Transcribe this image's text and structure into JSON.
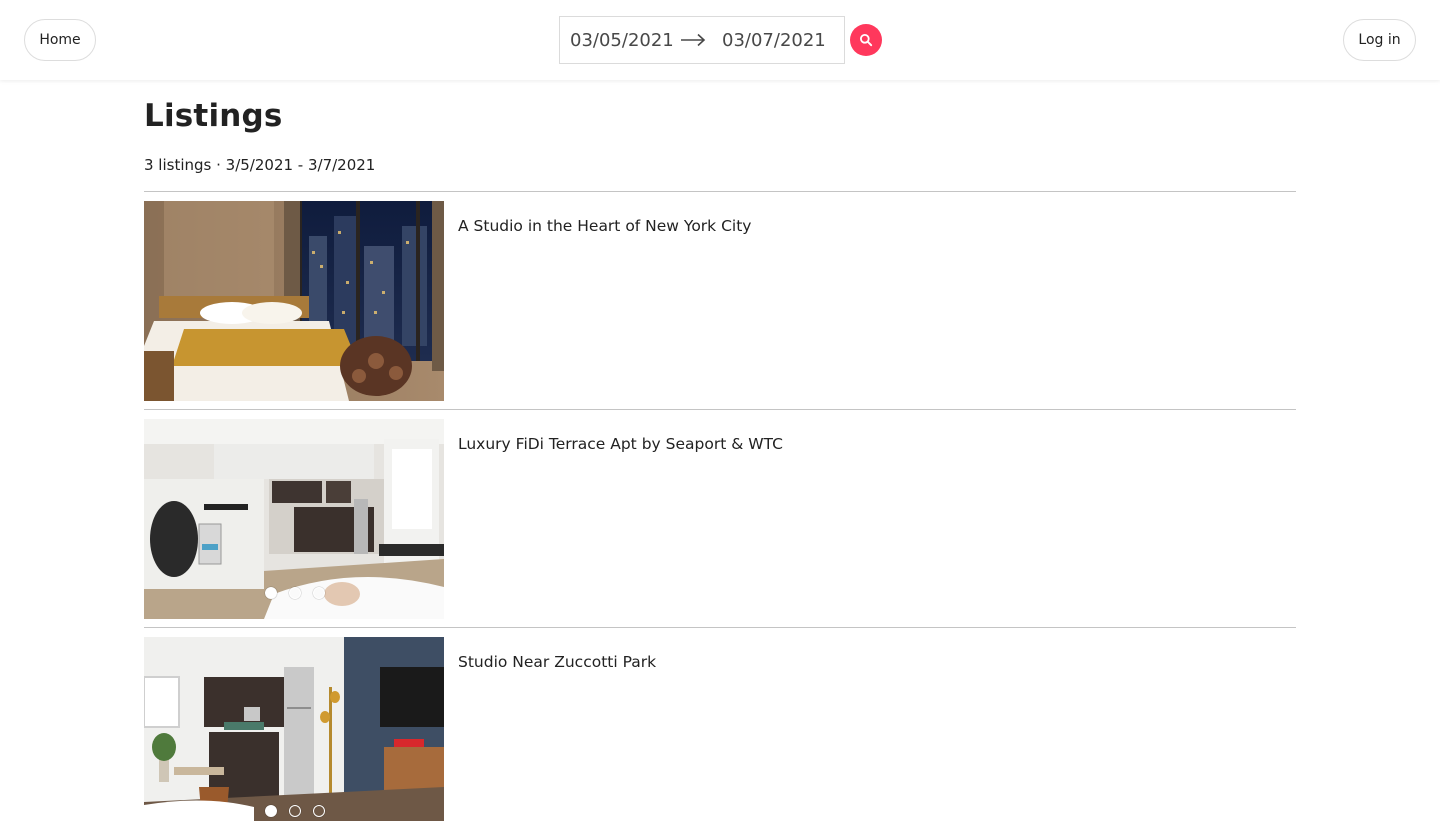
{
  "header": {
    "home_label": "Home",
    "login_label": "Log in",
    "check_in": "03/05/2021",
    "check_out": "03/07/2021",
    "arrow_icon": "arrow-right-icon",
    "search_icon": "search-icon",
    "accent_color": "#ff385c"
  },
  "page": {
    "title": "Listings",
    "summary": "3 listings · 3/5/2021 - 3/7/2021"
  },
  "listings": [
    {
      "title": "A Studio in the Heart of New York City",
      "photo_count": 3,
      "active_photo": 1,
      "dots_visible": false
    },
    {
      "title": "Luxury FiDi Terrace Apt by Seaport & WTC",
      "photo_count": 3,
      "active_photo": 1,
      "dots_visible": true
    },
    {
      "title": "Studio Near Zuccotti Park",
      "photo_count": 3,
      "active_photo": 1,
      "dots_visible": true
    }
  ]
}
